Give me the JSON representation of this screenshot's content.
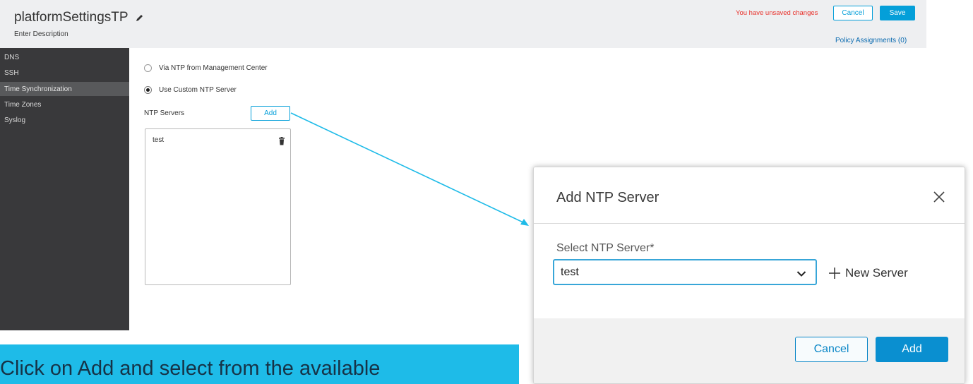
{
  "header": {
    "title": "platformSettingsTP",
    "description": "Enter Description",
    "unsaved_message": "You have unsaved changes",
    "cancel_label": "Cancel",
    "save_label": "Save",
    "policy_assignments": "Policy Assignments (0)"
  },
  "sidebar": {
    "items": [
      {
        "label": "DNS",
        "active": false
      },
      {
        "label": "SSH",
        "active": false
      },
      {
        "label": "Time Synchronization",
        "active": true
      },
      {
        "label": "Time Zones",
        "active": false
      },
      {
        "label": "Syslog",
        "active": false
      }
    ]
  },
  "time_sync": {
    "option_ntp_mc": "Via NTP from Management Center",
    "option_custom": "Use Custom NTP Server",
    "selected_option": "custom",
    "ntp_servers_label": "NTP Servers",
    "add_label": "Add",
    "servers": [
      "test"
    ]
  },
  "modal": {
    "title": "Add NTP Server",
    "select_label": "Select NTP Server*",
    "selected_value": "test",
    "new_server_label": "New Server",
    "cancel_label": "Cancel",
    "add_label": "Add"
  },
  "caption": {
    "text": "Click on Add and select from the available"
  },
  "colors": {
    "accent": "#049fd9",
    "sidebar_bg": "#39393b",
    "sidebar_active": "#58595b",
    "warning": "#e8312b",
    "caption_bg": "#1ebbe8"
  }
}
